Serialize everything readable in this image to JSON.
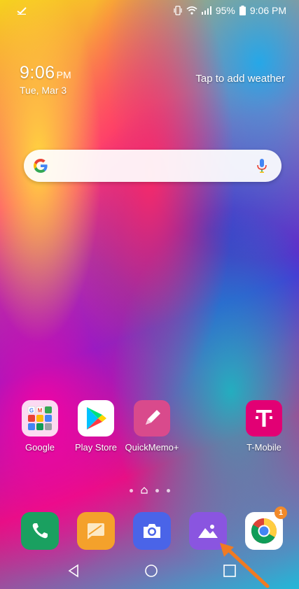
{
  "status_bar": {
    "battery": "95%",
    "time": "9:06 PM",
    "icons": [
      "checkmark-notification-icon",
      "vibrate-icon",
      "wifi-icon",
      "signal-icon",
      "battery-icon"
    ]
  },
  "clock": {
    "time": "9:06",
    "ampm": "PM",
    "date": "Tue, Mar 3"
  },
  "weather": {
    "label": "Tap to add weather"
  },
  "search": {
    "logo": "G",
    "icons": [
      "google-logo",
      "microphone-icon"
    ]
  },
  "apps": [
    {
      "label": "Google",
      "icon": "google-folder-icon"
    },
    {
      "label": "Play Store",
      "icon": "play-store-icon"
    },
    {
      "label": "QuickMemo+",
      "icon": "quickmemo-icon"
    },
    {
      "label": "T-Mobile",
      "icon": "t-mobile-icon"
    }
  ],
  "page_indicator": {
    "pages": 3,
    "current": "home"
  },
  "dock": [
    {
      "name": "phone",
      "icon": "phone-icon"
    },
    {
      "name": "messages",
      "icon": "messages-icon"
    },
    {
      "name": "camera",
      "icon": "camera-icon"
    },
    {
      "name": "gallery",
      "icon": "gallery-icon"
    },
    {
      "name": "chrome",
      "icon": "chrome-icon",
      "badge": "1"
    }
  ],
  "nav": {
    "icons": [
      "back-icon",
      "home-icon",
      "recents-icon"
    ]
  },
  "colors": {
    "play_store_tile": "#ffffff",
    "quickmemo_tile": "#d94a8c",
    "tmobile_tile": "#e20074",
    "phone_tile": "#1aa060",
    "messages_tile": "#f4a12b",
    "camera_tile": "#4a64e8",
    "gallery_tile": "#8a55e0",
    "chrome_tile": "#ffffff",
    "badge": "#f28a2a"
  }
}
